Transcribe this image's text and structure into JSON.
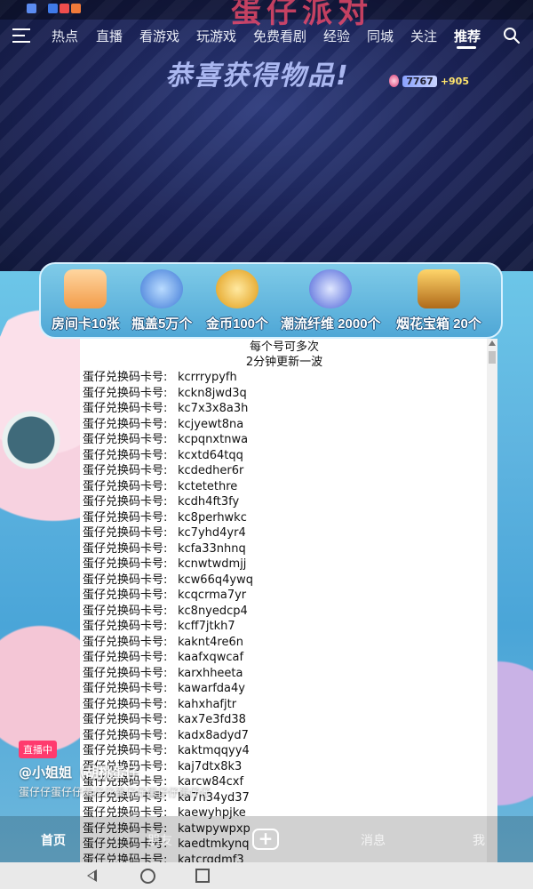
{
  "header_banner": {
    "text": "蛋仔派对"
  },
  "nav": {
    "tabs": [
      "热点",
      "直播",
      "看游戏",
      "玩游戏",
      "免费看剧",
      "经验",
      "同城",
      "关注",
      "推荐"
    ],
    "active_index": 8
  },
  "game": {
    "congrats": "恭喜获得物品!",
    "coin_value": "7767",
    "coin_plus": "+905"
  },
  "rewards": [
    {
      "label": "房间卡10张",
      "icon": "shop-icon",
      "color": "#f7b36a"
    },
    {
      "label": "瓶盖5万个",
      "icon": "bottle-cap-icon",
      "color": "#4d8fe0"
    },
    {
      "label": "金币100个",
      "icon": "gold-coin-icon",
      "color": "#f2b233"
    },
    {
      "label": "潮流纤维 2000个",
      "icon": "fiber-orb-icon",
      "color": "#5b78e8"
    },
    {
      "label": "烟花宝箱 20个",
      "icon": "treasure-chest-icon",
      "color": "#e3a43a"
    }
  ],
  "document": {
    "header_line1": "每个号可多次",
    "header_line2": "2分钟更新一波",
    "prefix": "蛋仔兑换码卡号:",
    "codes": [
      "kcrrrypyfh",
      "kckn8jwd3q",
      "kc7x3x8a3h",
      "kcjyewt8na",
      "kcpqnxtnwa",
      "kcxtd64tqq",
      "kcdedher6r",
      "kctetethre",
      "kcdh4ft3fy",
      "kc8perhwkc",
      "kc7yhd4yr4",
      "kcfa33nhnq",
      "kcnwtwdmjj",
      "kcw66q4ywq",
      "kcqcrma7yr",
      "kc8nyedcp4",
      "kcff7jtkh7",
      "kaknt4re6n",
      "kaafxqwcaf",
      "karxhheeta",
      "kawarfda4y",
      "kahxhafjtr",
      "kax7e3fd38",
      "kadx8adyd7",
      "kaktmqqyy4",
      "kaj7dtx8k3",
      "karcw84cxf",
      "ka7n34yd37",
      "kaewyhpjke",
      "katwpywpxp",
      "kaedtmkynq",
      "katcrqdmf3"
    ]
  },
  "live": {
    "badge": "直播中",
    "username": "@小姐姐（胡桃蛋仔",
    "description": "蛋仔仔蛋仔仔蛋仔仔蛋仔仔蛋仔仔蛋仔仔"
  },
  "bottom_tabs": {
    "home": "首页",
    "friends": "朋友",
    "messages": "消息",
    "me": "我"
  },
  "colors": {
    "accent_red": "#ff3a6e",
    "reward_strip": "#4fa7d6"
  }
}
